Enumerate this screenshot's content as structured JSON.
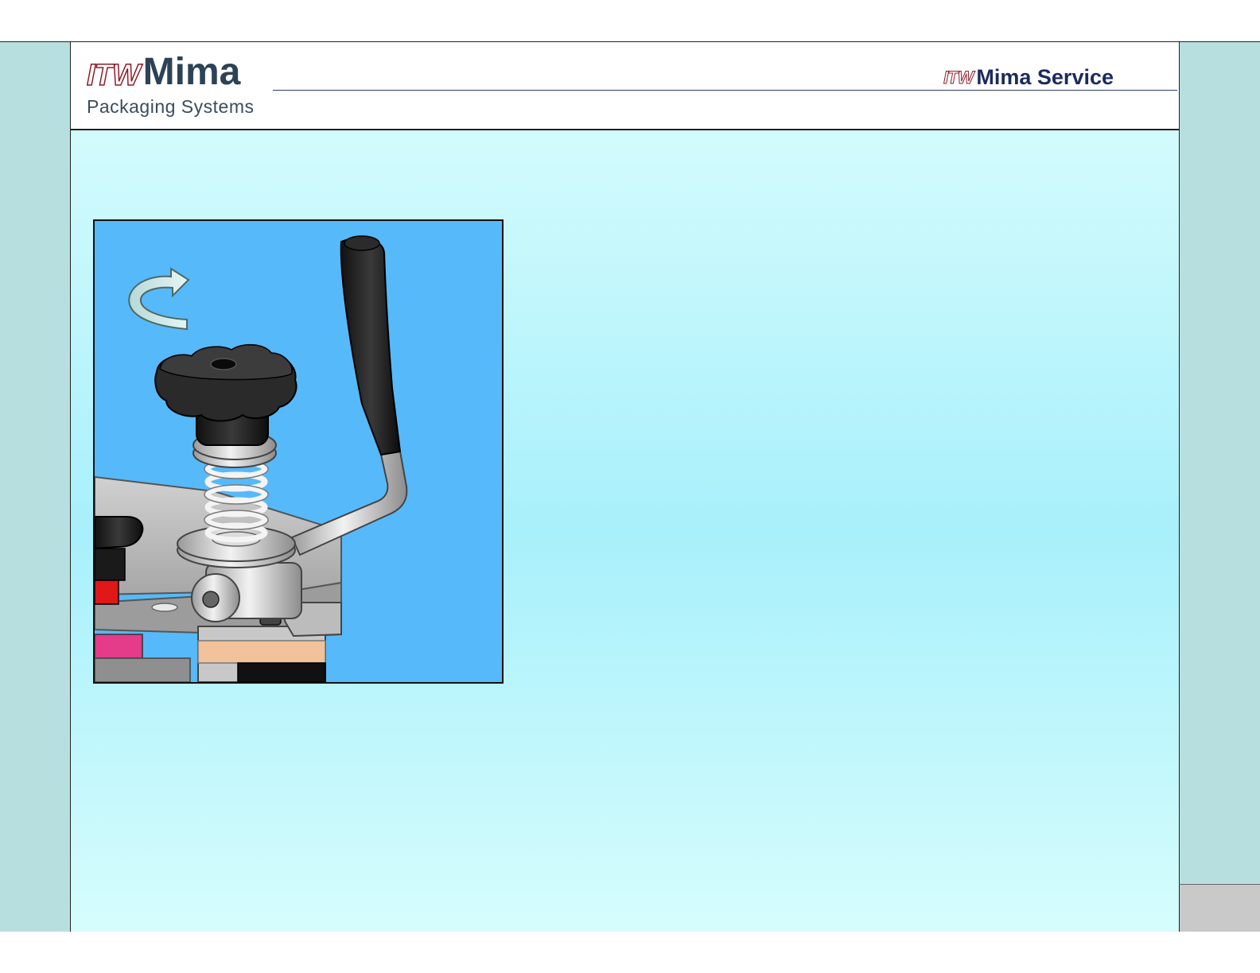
{
  "header": {
    "logo": {
      "prefix": "ITW",
      "name": "Mima"
    },
    "tagline": "Packaging Systems",
    "service": {
      "prefix": "ITW",
      "name": "Mima Service"
    }
  },
  "figure": {
    "subject": "mechanical-assembly-illustration"
  },
  "colors": {
    "side_panel": "#b8dfe0",
    "content_top": "#d3fbfd",
    "content_mid": "#a8f0fb",
    "figure_background": "#56b9f9",
    "brand_red": "#8b1c2a",
    "brand_navy": "#2c4256"
  }
}
